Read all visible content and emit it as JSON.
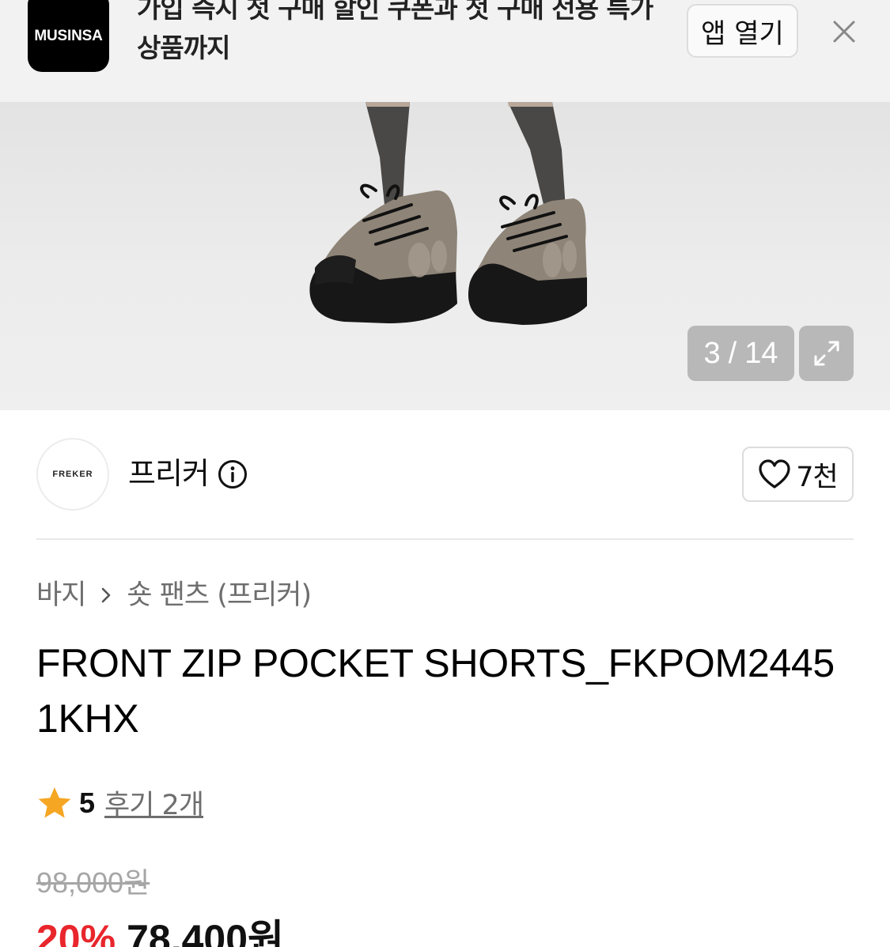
{
  "banner": {
    "app_logo_text": "MUSINSA",
    "message": "가입 즉시 첫 구매 할인 쿠폰과 첫 구매 전용 특가 상품까지",
    "open_app_label": "앱 열기",
    "close_icon": "close-icon"
  },
  "gallery": {
    "current": "3",
    "separator": "/",
    "total": "14",
    "expand_icon": "expand-icon"
  },
  "brand": {
    "logo_text": "FREKER",
    "name": "프리커",
    "info_icon": "info-icon",
    "like_icon": "heart-icon",
    "like_count": "7천"
  },
  "breadcrumb": {
    "category": "바지",
    "subcategory": "숏 팬츠 (프리커)",
    "separator_icon": "chevron-right-icon"
  },
  "product": {
    "title": "FRONT ZIP POCKET SHORTS_FKPOM2445 1KHX"
  },
  "rating": {
    "star_icon": "star-icon",
    "score": "5",
    "reviews_label": "후기 2개"
  },
  "price": {
    "original": "98,000원",
    "discount": "20%",
    "sale": "78,400원"
  },
  "colors": {
    "accent_red": "#e8262c",
    "star_orange": "#f5a623"
  }
}
